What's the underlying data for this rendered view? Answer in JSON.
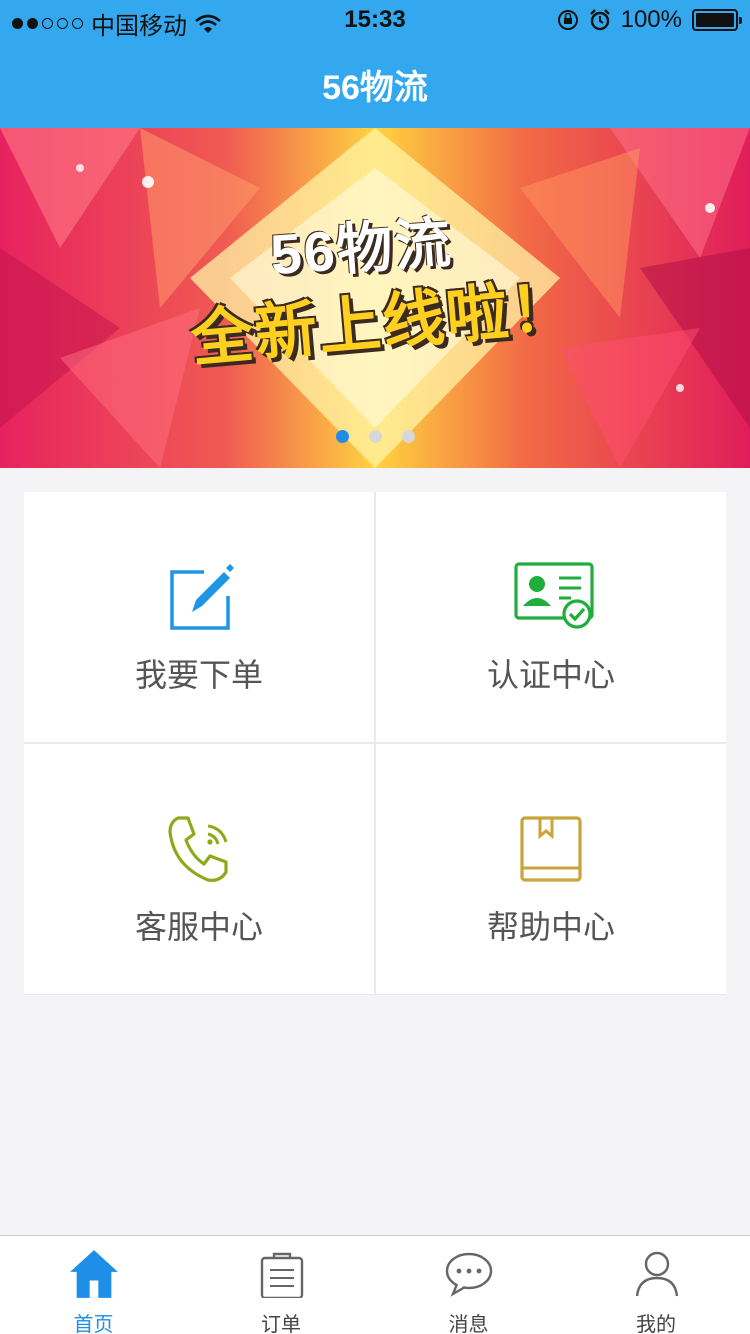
{
  "status_bar": {
    "carrier": "中国移动",
    "time": "15:33",
    "battery": "100%"
  },
  "nav": {
    "title": "56物流"
  },
  "banner": {
    "line1": "56物流",
    "line2": "全新上线啦！",
    "page_count": 3,
    "active_page": 1
  },
  "menu": [
    {
      "label": "我要下单",
      "icon": "edit-icon",
      "color": "#1e96e6"
    },
    {
      "label": "认证中心",
      "icon": "id-card-icon",
      "color": "#1fad3c"
    },
    {
      "label": "客服中心",
      "icon": "phone-icon",
      "color": "#8aab17"
    },
    {
      "label": "帮助中心",
      "icon": "book-icon",
      "color": "#c9a43a"
    }
  ],
  "tabs": [
    {
      "label": "首页",
      "icon": "home-icon",
      "active": true
    },
    {
      "label": "订单",
      "icon": "clipboard-icon",
      "active": false
    },
    {
      "label": "消息",
      "icon": "chat-icon",
      "active": false
    },
    {
      "label": "我的",
      "icon": "user-icon",
      "active": false
    }
  ],
  "colors": {
    "primary": "#33a8ef",
    "active_tab": "#1e8ee8",
    "background": "#f4f3f5"
  }
}
